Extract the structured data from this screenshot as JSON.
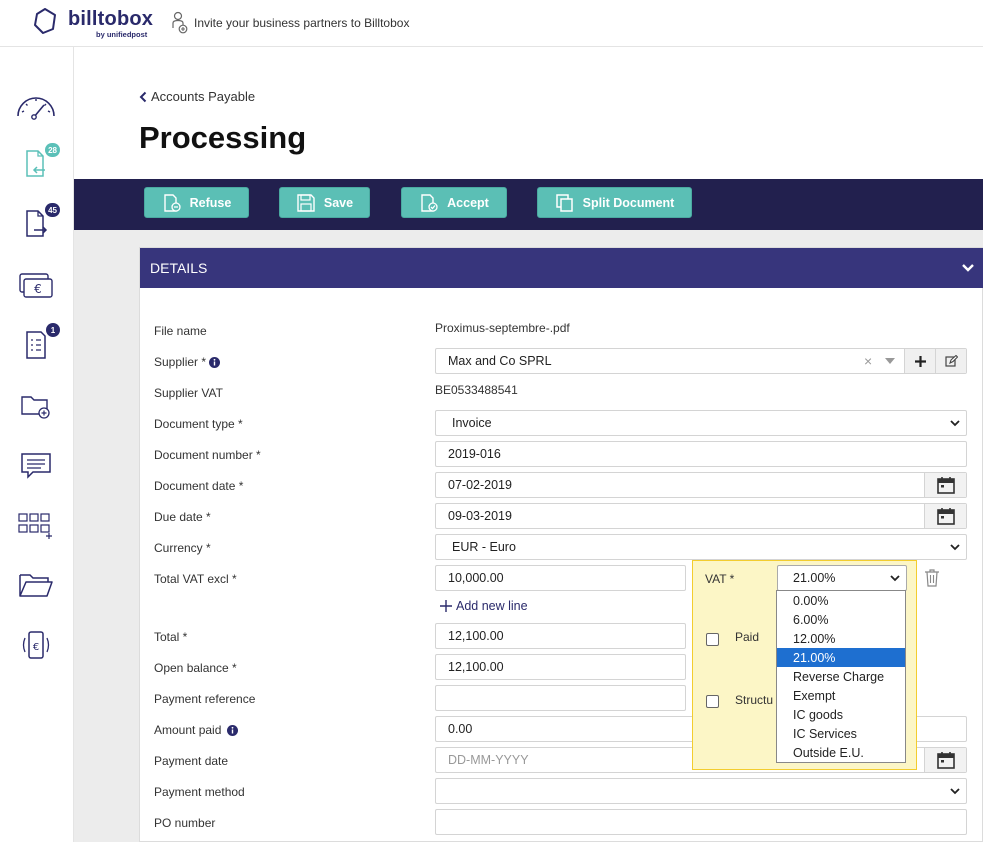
{
  "header": {
    "brand": "billtobox",
    "brand_sub": "by unifiedpost",
    "invite_text": "Invite your business partners to Billtobox"
  },
  "sidebar": {
    "items": [
      {
        "icon": "dashboard-gauge-icon"
      },
      {
        "icon": "incoming-documents-icon",
        "badge": "28"
      },
      {
        "icon": "outgoing-documents-icon",
        "badge": "45"
      },
      {
        "icon": "payments-icon"
      },
      {
        "icon": "tasks-icon",
        "badge": "1"
      },
      {
        "icon": "add-folder-icon"
      },
      {
        "icon": "messages-icon"
      },
      {
        "icon": "apps-grid-icon"
      },
      {
        "icon": "folder-icon"
      },
      {
        "icon": "mobile-payment-icon"
      }
    ]
  },
  "breadcrumb": {
    "back_label": "Accounts Payable"
  },
  "page_title": "Processing",
  "toolbar": {
    "refuse": "Refuse",
    "save": "Save",
    "accept": "Accept",
    "split": "Split Document"
  },
  "details": {
    "header": "DETAILS",
    "labels": {
      "file_name": "File name",
      "supplier": "Supplier *",
      "supplier_vat": "Supplier VAT",
      "document_type": "Document type *",
      "document_number": "Document number *",
      "document_date": "Document date *",
      "due_date": "Due date *",
      "currency": "Currency *",
      "total_vat_excl": "Total VAT excl *",
      "total": "Total *",
      "open_balance": "Open balance *",
      "payment_reference": "Payment reference",
      "amount_paid": "Amount paid",
      "payment_date": "Payment date",
      "payment_method": "Payment method",
      "po_number": "PO number"
    },
    "values": {
      "file_name": "Proximus-septembre-.pdf",
      "supplier": "Max and Co SPRL",
      "supplier_vat": "BE0533488541",
      "document_type": "Invoice",
      "document_number": "2019-016",
      "document_date": "07-02-2019",
      "due_date": "09-03-2019",
      "currency": "EUR - Euro",
      "total_vat_excl": "10,000.00",
      "total": "12,100.00",
      "open_balance": "12,100.00",
      "payment_reference": "",
      "amount_paid": "0.00",
      "payment_date_placeholder": "DD-MM-YYYY",
      "payment_method": "",
      "po_number": ""
    },
    "add_new_line": "Add new line",
    "vat": {
      "label": "VAT *",
      "selected": "21.00%",
      "options": [
        "0.00%",
        "6.00%",
        "12.00%",
        "21.00%",
        "Reverse Charge",
        "Exempt",
        "IC goods",
        "IC Services",
        "Outside E.U."
      ]
    },
    "paid_label": "Paid",
    "structured_label": "Structu"
  },
  "colors": {
    "navy": "#22204e",
    "panel_header": "#37357c",
    "teal_button": "#5bbfb5",
    "highlight": "#fcf6c6",
    "selected_option": "#1e6fd0"
  }
}
